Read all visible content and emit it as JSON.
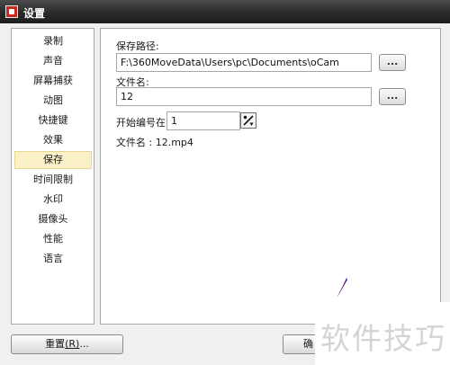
{
  "window": {
    "title": "设置"
  },
  "sidebar": {
    "items": [
      {
        "label": "录制",
        "active": false
      },
      {
        "label": "声音",
        "active": false
      },
      {
        "label": "屏幕捕获",
        "active": false
      },
      {
        "label": "动图",
        "active": false
      },
      {
        "label": "快捷键",
        "active": false
      },
      {
        "label": "效果",
        "active": false
      },
      {
        "label": "保存",
        "active": true
      },
      {
        "label": "时间限制",
        "active": false
      },
      {
        "label": "水印",
        "active": false
      },
      {
        "label": "摄像头",
        "active": false
      },
      {
        "label": "性能",
        "active": false
      },
      {
        "label": "语言",
        "active": false
      }
    ]
  },
  "save": {
    "path_label": "保存路径:",
    "path_value": "F:\\360MoveData\\Users\\pc\\Documents\\oCam",
    "browse_label": "...",
    "filename_label": "文件名:",
    "filename_value": "12",
    "filename_btn_label": "...",
    "start_label": "开始编号在:",
    "start_value": "1",
    "preview_label": "文件名 : 12.mp4"
  },
  "footer": {
    "reset_label": "重置",
    "reset_mnemonic": "(R)",
    "reset_suffix": "...",
    "ok_label": "确"
  },
  "watermark": {
    "text": "软件技巧"
  },
  "colors": {
    "titlebar": "#2a2a2a",
    "active_item_bg": "#fbf1c9",
    "purple_stroke": "#5e1a86"
  }
}
